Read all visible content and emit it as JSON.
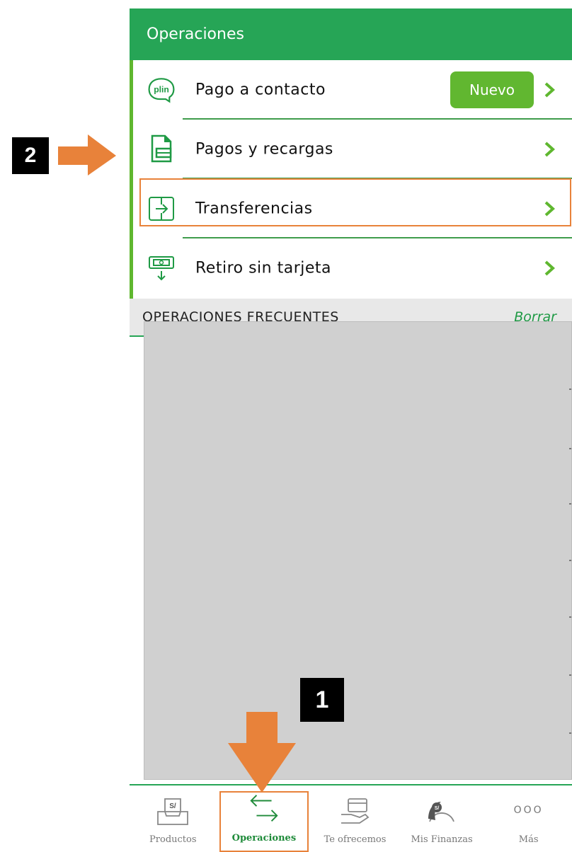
{
  "header": {
    "title": "Operaciones"
  },
  "operations": {
    "items": [
      {
        "label": "Pago a contacto",
        "icon": "plin-icon",
        "badge": "Nuevo"
      },
      {
        "label": "Pagos y recargas",
        "icon": "bill-icon"
      },
      {
        "label": "Transferencias",
        "icon": "transfer-icon"
      },
      {
        "label": "Retiro sin tarjeta",
        "icon": "cash-withdraw-icon"
      }
    ],
    "plin_text": "plin"
  },
  "frequent": {
    "title": "OPERACIONES FRECUENTES",
    "clear_label": "Borrar"
  },
  "tabbar": {
    "items": [
      {
        "label": "Productos",
        "icon": "wallet-icon",
        "icon_text": "S/"
      },
      {
        "label": "Operaciones",
        "icon": "arrows-exchange-icon",
        "active": true
      },
      {
        "label": "Te ofrecemos",
        "icon": "card-hand-icon"
      },
      {
        "label": "Mis Finanzas",
        "icon": "gauge-icon",
        "icon_text": "S/"
      },
      {
        "label": "Más",
        "icon": "more-dots-icon",
        "icon_text": "OOO"
      }
    ]
  },
  "annotations": {
    "step1": "1",
    "step2": "2"
  },
  "colors": {
    "primary": "#26a556",
    "accent_green": "#61b730",
    "annotation_orange": "#e8823a"
  }
}
